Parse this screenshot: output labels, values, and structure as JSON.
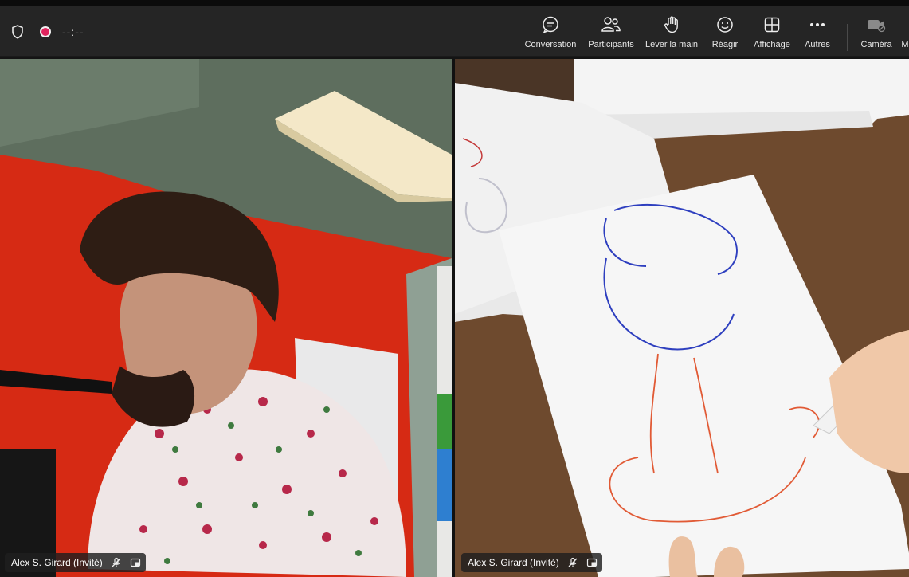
{
  "toolbar": {
    "timer": "--:--",
    "buttons": [
      {
        "label": "Conversation",
        "icon": "chat-icon"
      },
      {
        "label": "Participants",
        "icon": "people-icon"
      },
      {
        "label": "Lever la main",
        "icon": "raise-hand-icon"
      },
      {
        "label": "Réagir",
        "icon": "smiley-icon"
      },
      {
        "label": "Affichage",
        "icon": "grid-view-icon"
      },
      {
        "label": "Autres",
        "icon": "more-icon"
      },
      {
        "label": "Caméra",
        "icon": "camera-icon"
      },
      {
        "label": "M",
        "icon": "mic-icon"
      }
    ]
  },
  "participants": [
    {
      "name": "Alex S. Girard (Invité)",
      "muted": true
    },
    {
      "name": "Alex S. Girard (Invité)",
      "muted": true
    }
  ],
  "colors": {
    "toolbar_bg": "#252525",
    "recording": "#e0245e"
  }
}
